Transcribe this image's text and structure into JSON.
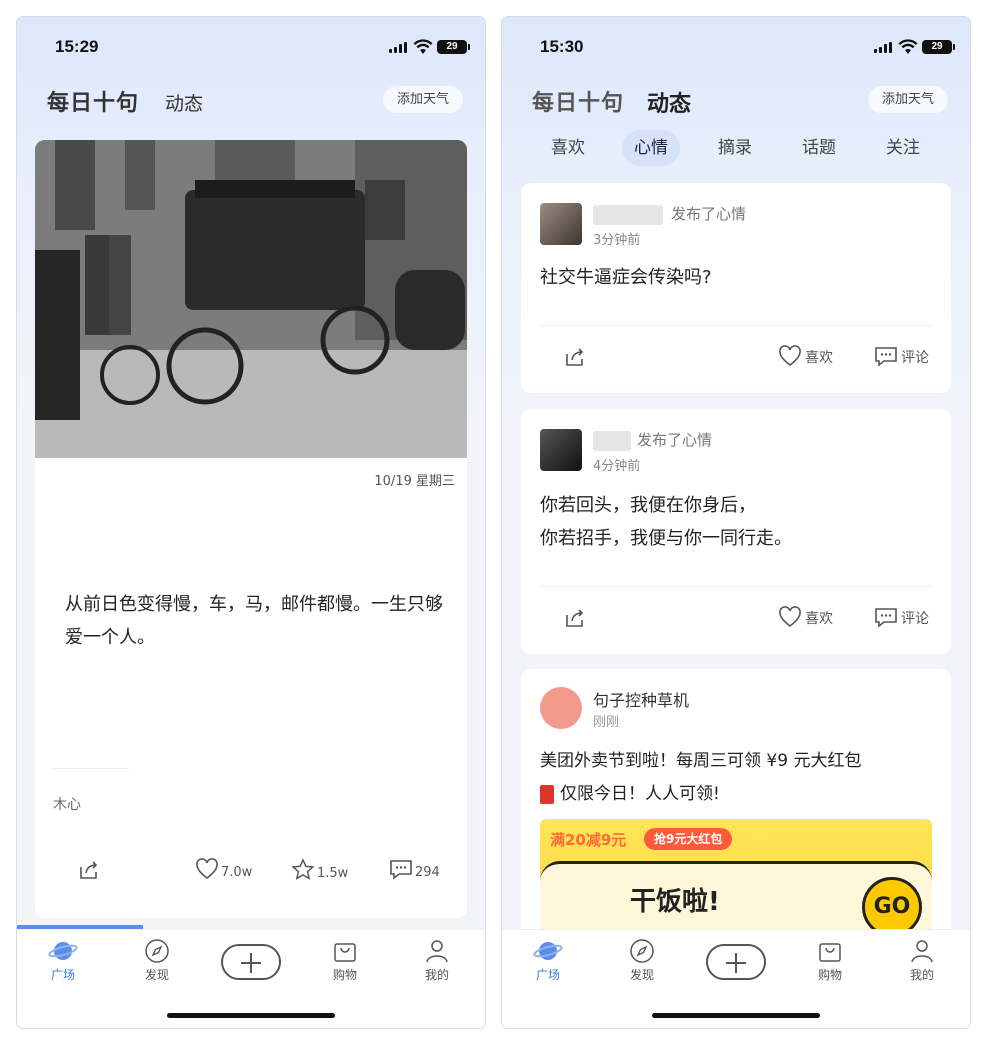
{
  "left": {
    "status": {
      "time": "15:29",
      "battery": "29"
    },
    "header": {
      "brand": "每日十句",
      "section": "动态",
      "weather_button": "添加天气"
    },
    "card": {
      "date": "10/19 星期三",
      "text": "从前日色变得慢，车，马，邮件都慢。一生只够爱一个人。",
      "author": "木心",
      "likes": "7.0w",
      "stars": "1.5w",
      "comments": "294"
    },
    "progress": 0.27
  },
  "right": {
    "status": {
      "time": "15:30",
      "battery": "29"
    },
    "header": {
      "brand": "每日十句",
      "section": "动态",
      "weather_button": "添加天气"
    },
    "tabs": [
      "喜欢",
      "心情",
      "摘录",
      "话题",
      "关注"
    ],
    "active_tab": "心情",
    "posts": [
      {
        "action": "发布了心情",
        "time": "3分钟前",
        "lines": [
          "社交牛逼症会传染吗?"
        ],
        "like_label": "喜欢",
        "comment_label": "评论"
      },
      {
        "action": "发布了心情",
        "time": "4分钟前",
        "lines": [
          "你若回头，我便在你身后，",
          "你若招手，我便与你一同行走。"
        ],
        "like_label": "喜欢",
        "comment_label": "评论"
      }
    ],
    "promo": {
      "name": "句子控种草机",
      "time": "刚刚",
      "text_line1": "美团外卖节到啦！每周三可领 ¥9 元大红包",
      "text_line2": "仅限今日！人人可领!",
      "banner_deal": "满20减9元",
      "banner_pill": "抢9元大红包",
      "banner_title": "干饭啦!",
      "banner_go": "GO"
    }
  },
  "tabbar": [
    "广场",
    "发现",
    "购物",
    "我的"
  ],
  "colors": {
    "accent": "#3a7be0",
    "promo_yellow": "#ffd630",
    "promo_red": "#ff5b3a"
  }
}
